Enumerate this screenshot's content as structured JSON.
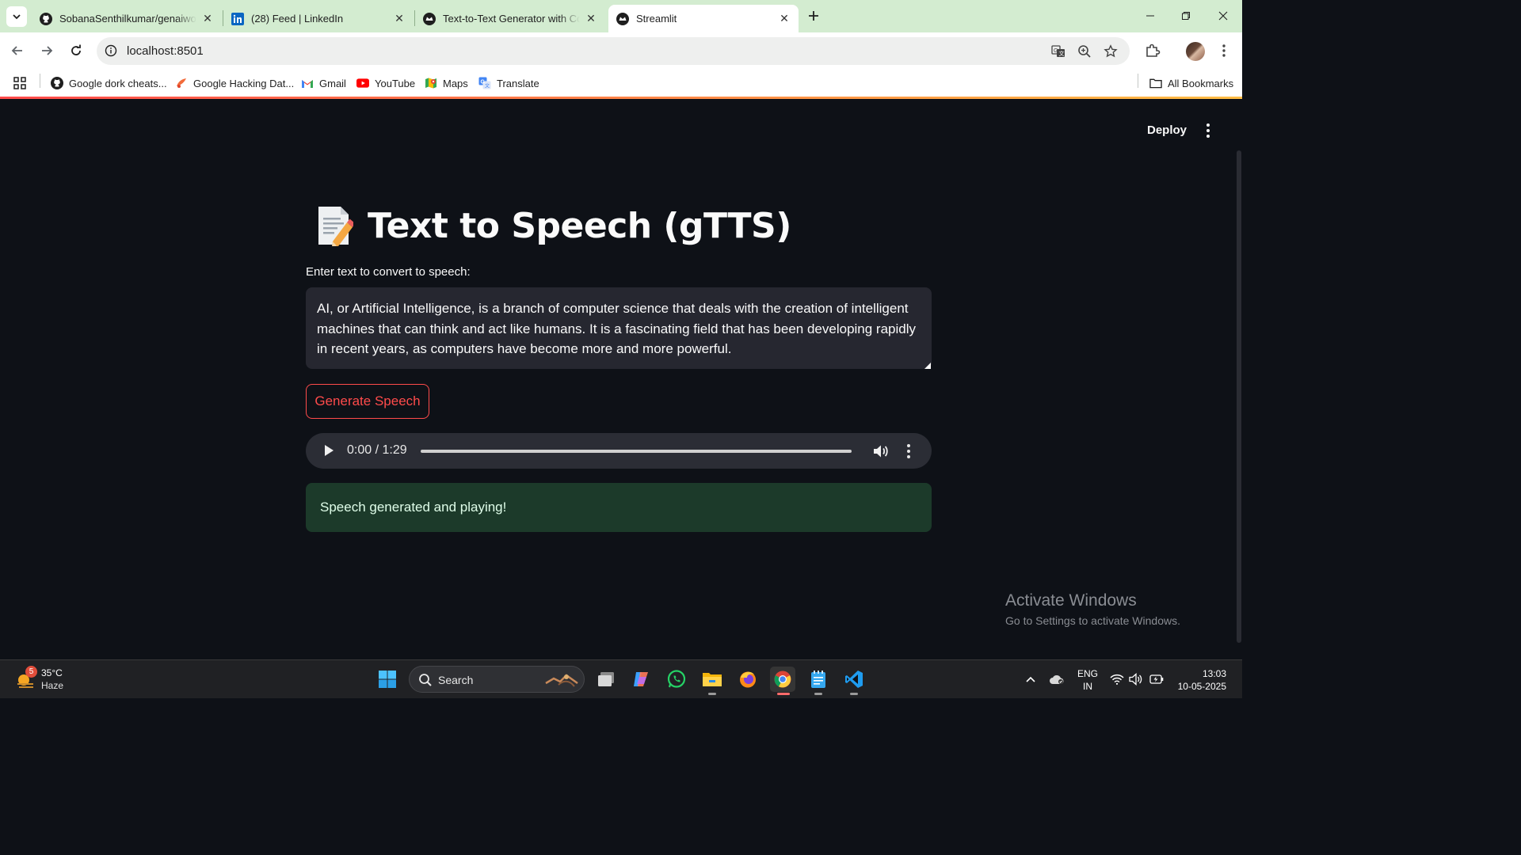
{
  "browser": {
    "tabs": [
      {
        "label": "SobanaSenthilkumar/genaiworkshop",
        "icon": "github-icon",
        "active": false
      },
      {
        "label": "(28) Feed | LinkedIn",
        "icon": "linkedin-icon",
        "active": false
      },
      {
        "label": "Text-to-Text Generator with Cohere",
        "icon": "streamlit-icon",
        "active": false
      },
      {
        "label": "Streamlit",
        "icon": "streamlit-icon",
        "active": true
      }
    ],
    "url": "localhost:8501",
    "bookmarks": [
      {
        "label": "Google dork cheats...",
        "icon": "github-icon"
      },
      {
        "label": "Google Hacking Dat...",
        "icon": "exploit-db-icon"
      },
      {
        "label": "Gmail",
        "icon": "gmail-icon"
      },
      {
        "label": "YouTube",
        "icon": "youtube-icon"
      },
      {
        "label": "Maps",
        "icon": "maps-icon"
      },
      {
        "label": "Translate",
        "icon": "translate-icon"
      }
    ],
    "all_bookmarks": "All Bookmarks"
  },
  "app": {
    "deploy_label": "Deploy",
    "title": "Text to Speech (gTTS)",
    "title_icon": "memo-icon",
    "input_label": "Enter text to convert to speech:",
    "input_value": "AI, or Artificial Intelligence, is a branch of computer science that deals with the creation of intelligent machines that can think and act like humans. It is a fascinating field that has been developing rapidly in recent years, as computers have become more and more powerful.",
    "generate_button": "Generate Speech",
    "audio": {
      "time": "0:00 / 1:29",
      "progress": 0
    },
    "success_message": "Speech generated and playing!",
    "colors": {
      "primary": "#ff4b4b",
      "background": "#0e1117",
      "input_bg": "#262730",
      "success_bg": "#1c3a2a"
    }
  },
  "watermark": {
    "title": "Activate Windows",
    "subtitle": "Go to Settings to activate Windows."
  },
  "taskbar": {
    "weather_badge": "5",
    "temperature": "35°C",
    "condition": "Haze",
    "search_label": "Search",
    "language": "ENG",
    "region": "IN",
    "time": "13:03",
    "date": "10-05-2025"
  }
}
